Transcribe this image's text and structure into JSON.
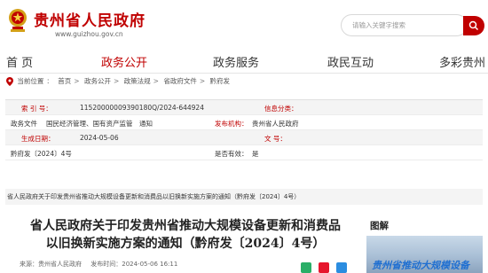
{
  "header": {
    "site_name": "贵州省人民政府",
    "site_url": "www.guizhou.gov.cn",
    "emblem_icon": "national-emblem-icon",
    "search_placeholder": "请输入关键字搜索",
    "brand_color": "#c00000"
  },
  "nav": {
    "items": [
      {
        "label": "首 页",
        "active": false
      },
      {
        "label": "政务公开",
        "active": true
      },
      {
        "label": "政务服务",
        "active": false
      },
      {
        "label": "政民互动",
        "active": false
      },
      {
        "label": "多彩贵州",
        "active": false
      }
    ]
  },
  "breadcrumb": {
    "icon": "location-pin-icon",
    "items": [
      "当前位置",
      "首页",
      "政务公开",
      "政策法规",
      "省政府文件",
      "黔府发"
    ]
  },
  "info": {
    "index_label": "索 引 号：",
    "index_value": "11520000009390180Q/2024-644924",
    "source_label": "信息分类：",
    "source_value": "",
    "category_label": "政务文件",
    "category_value": "国民经济管理、国有资产监管　通知",
    "issuer_label": "发布机构：",
    "issuer_value": "贵州省人民政府",
    "date_label": "生成日期：",
    "date_value": "2024-05-06",
    "docno_label": "文 号：",
    "docno_value": "",
    "docno_full": "黔府发〔2024〕4号",
    "valid_label": "是否有效：",
    "valid_value": "是",
    "notice_text": "省人民政府关于印发贵州省推动大规模设备更新和消费品以旧换新实施方案的通知（黔府发〔2024〕4号）"
  },
  "article": {
    "title_line1": "省人民政府关于印发贵州省推动大规模设备更新和消费品",
    "title_line2": "以旧换新实施方案的通知（黔府发〔2024〕4号）",
    "source_label": "来源：",
    "source_value": "贵州省人民政府",
    "time_label": "发布时间：",
    "time_value": "2024-05-06 16:11",
    "share_icons": [
      "wechat-share-icon",
      "weibo-share-icon",
      "qq-share-icon"
    ],
    "share_colors": [
      "#2aae67",
      "#e6162d",
      "#2b8de0"
    ]
  },
  "sidebar": {
    "title": "图解",
    "caption": "贵州省推动大规模设备"
  }
}
